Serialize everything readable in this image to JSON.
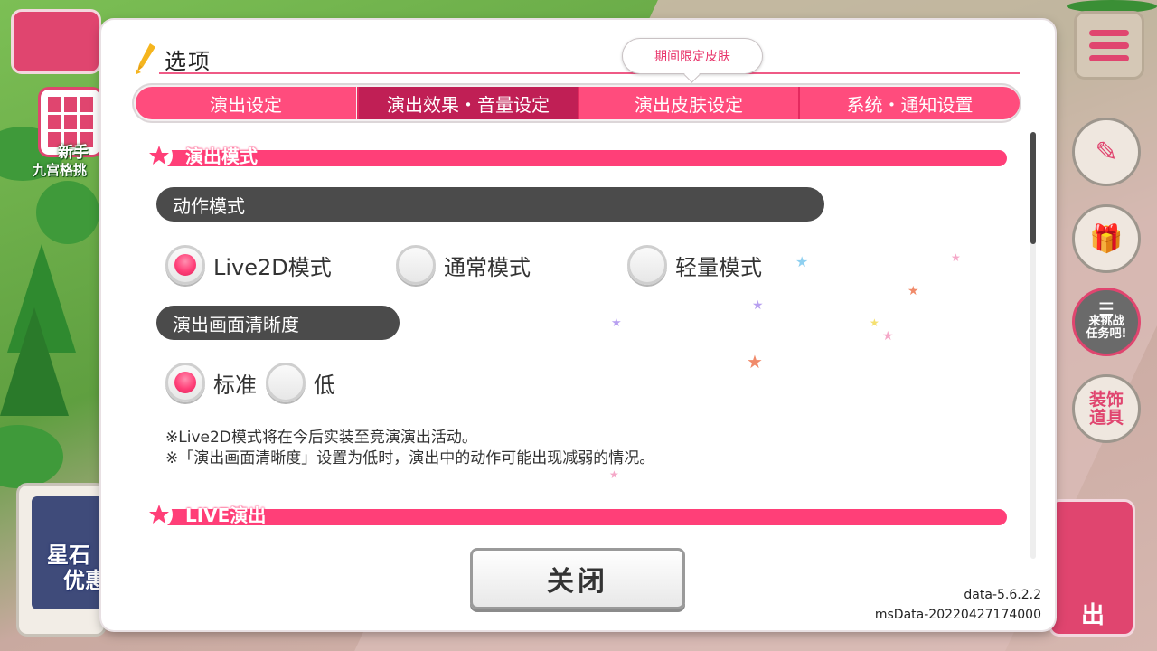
{
  "dialog": {
    "title": "选项",
    "limited_tag": "期间限定皮肤",
    "close_label": "关闭"
  },
  "tabs": [
    {
      "label": "演出设定",
      "active": false
    },
    {
      "label": "演出效果・音量设定",
      "active": true
    },
    {
      "label": "演出皮肤设定",
      "active": false
    },
    {
      "label": "系统・通知设置",
      "active": false
    }
  ],
  "sections": {
    "perf_mode": {
      "title": "演出模式",
      "action_mode": {
        "header": "动作模式",
        "options": [
          "Live2D模式",
          "通常模式",
          "轻量模式"
        ],
        "selected": "Live2D模式"
      },
      "clarity": {
        "header": "演出画面清晰度",
        "options": [
          "标准",
          "低"
        ],
        "selected": "标准"
      },
      "notes": [
        "※Live2D模式将在今后实装至竞演演出活动。",
        "※「演出画面清晰度」设置为低时，演出中的动作可能出现减弱的情况。"
      ]
    },
    "live": {
      "title": "LIVE演出"
    }
  },
  "version": {
    "data": "data-5.6.2.2",
    "ms_data": "msData-20220427174000"
  },
  "background": {
    "newbie_label_1": "新手",
    "newbie_label_2": "九宫格挑",
    "challenge_label_1": "来挑战",
    "challenge_label_2": "任务吧!",
    "deco_label_1": "装饰",
    "deco_label_2": "道具",
    "banner_text_1": "星石",
    "banner_text_2": "优惠",
    "live_text": "出"
  },
  "colors": {
    "accent": "#ff3f78",
    "tab_active": "#c01f55",
    "tab": "#ff4c7d"
  },
  "icons": {
    "title": "pen-icon",
    "section": "star-icon",
    "menu": "hamburger-icon"
  }
}
